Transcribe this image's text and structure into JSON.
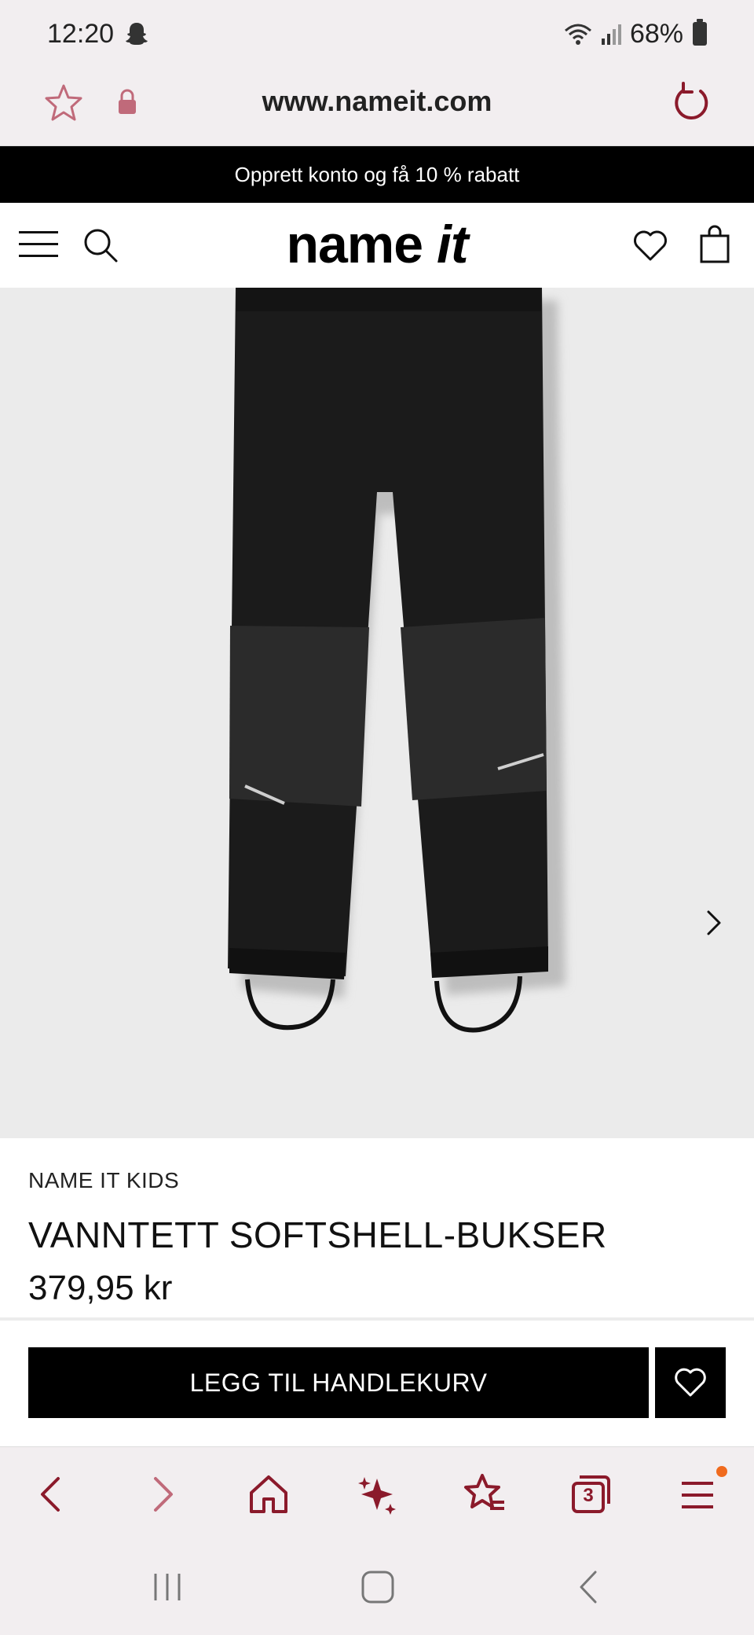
{
  "status_bar": {
    "time": "12:20",
    "battery": "68%"
  },
  "browser": {
    "url": "www.nameit.com",
    "tab_count": "3"
  },
  "promo": {
    "text": "Opprett konto og få 10 % rabatt"
  },
  "site_header": {
    "logo_name": "name",
    "logo_it": "it"
  },
  "product": {
    "brand": "NAME IT KIDS",
    "title": "VANNTETT SOFTSHELL-BUKSER",
    "price": "379,95 kr",
    "add_to_cart_label": "LEGG TIL HANDLEKURV"
  },
  "colors": {
    "browser_accent": "#8b1a2b",
    "browser_bg": "#f2eef0",
    "banner_bg": "#000000",
    "notification_dot": "#f06a1d"
  },
  "icons": {
    "address_bar": [
      "star-icon",
      "lock-icon",
      "reload-icon"
    ],
    "site_header": [
      "menu-icon",
      "search-icon",
      "heart-icon",
      "bag-icon"
    ],
    "browser_toolbar": [
      "back-icon",
      "forward-icon",
      "home-icon",
      "sparkle-icon",
      "bookmarks-icon",
      "tabs-icon",
      "menu-icon"
    ],
    "system_nav": [
      "recents-icon",
      "home-icon",
      "back-icon"
    ]
  }
}
